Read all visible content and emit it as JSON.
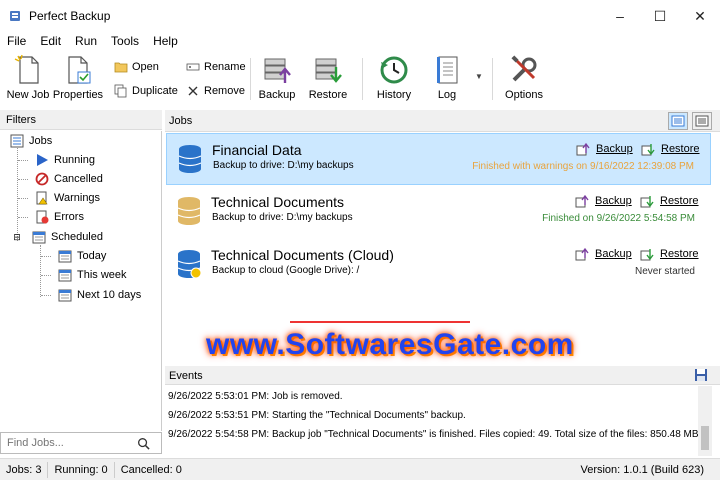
{
  "window": {
    "title": "Perfect Backup",
    "minimize_glyph": "–",
    "maximize_glyph": "☐",
    "close_glyph": "✕"
  },
  "menu": [
    "File",
    "Edit",
    "Run",
    "Tools",
    "Help"
  ],
  "toolbar": {
    "new_job": "New Job",
    "properties": "Properties",
    "open": "Open",
    "duplicate": "Duplicate",
    "rename": "Rename",
    "remove": "Remove",
    "backup": "Backup",
    "restore": "Restore",
    "history": "History",
    "log": "Log",
    "options": "Options"
  },
  "filters": {
    "header": "Filters",
    "items": [
      "Jobs",
      "Running",
      "Cancelled",
      "Warnings",
      "Errors",
      "Scheduled",
      "Today",
      "This week",
      "Next 10 days"
    ]
  },
  "find": {
    "placeholder": "Find Jobs..."
  },
  "jobs": {
    "header": "Jobs",
    "backup_label": "Backup",
    "restore_label": "Restore",
    "items": [
      {
        "name": "Financial Data",
        "dest": "Backup to drive: D:\\my backups",
        "status": "Finished with warnings on 9/16/2022 12:39:08 PM",
        "status_color": "#e8a33d"
      },
      {
        "name": "Technical Documents",
        "dest": "Backup to drive: D:\\my backups",
        "status": "Finished on 9/26/2022 5:54:58 PM",
        "status_color": "#3a8c3a"
      },
      {
        "name": "Technical Documents (Cloud)",
        "dest": "Backup to cloud (Google Drive): /",
        "status": "Never started",
        "status_color": "#333333"
      }
    ]
  },
  "watermark": "www.SoftwaresGate.com",
  "events": {
    "header": "Events",
    "items": [
      "9/26/2022 5:53:01 PM: Job is removed.",
      "9/26/2022 5:53:51 PM: Starting the \"Technical Documents\" backup.",
      "9/26/2022 5:54:58 PM: Backup job \"Technical Documents\" is finished. Files copied: 49. Total size of the files: 850.48 MB"
    ]
  },
  "statusbar": {
    "jobs": "Jobs: 3",
    "running": "Running: 0",
    "cancelled": "Cancelled: 0",
    "version": "Version: 1.0.1 (Build 623)"
  },
  "colors": {
    "accent": "#0078d7",
    "selected_bg": "#cce8ff"
  }
}
